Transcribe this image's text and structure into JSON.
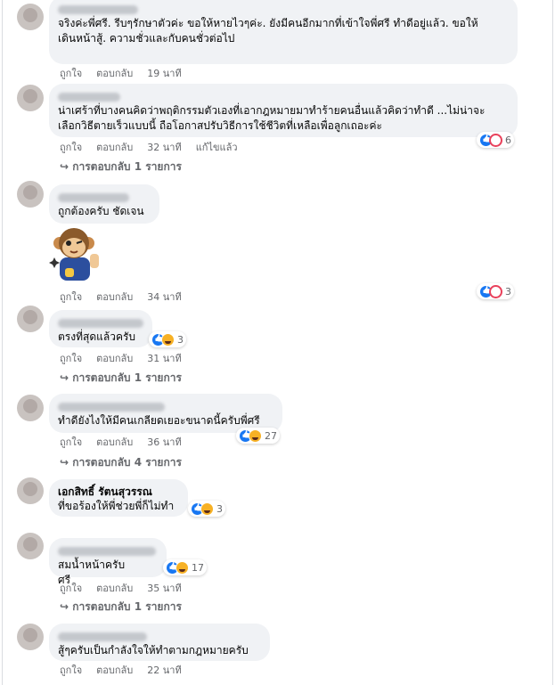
{
  "labels": {
    "like": "ถูกใจ",
    "reply": "ตอบกลับ",
    "edited": "แก้ไขแล้ว"
  },
  "comments": [
    {
      "author": "",
      "text": "จริงค่ะพี่ศรี. รีบๆรักษาตัวค่ะ ขอให้หายไวๆค่ะ. ยังมีคนอีกมากที่เข้าใจพี่ศรี ทำดีอยู่แล้ว. ขอให้\nเดินหน้าสู้. ความชั่วและกับคนชั่วต่อไป",
      "time": "19 นาที"
    },
    {
      "author": "",
      "text": "น่าเศร้าที่บางคนคิดว่าพฤติกรรมตัวเองที่เอากฎหมายมาทำร้ายคนอื่นแล้วคิดว่าทำดี ...ไม่น่าจะ\nเลือกวิธีตายเร็วแบบนี้ ถือโอกาสปรับวิธีการใช้ชีวิตที่เหลือเพื่อลูกเถอะค่ะ",
      "time": "32 นาที",
      "edited": true,
      "reactions": "6",
      "replies": "การตอบกลับ 1 รายการ"
    },
    {
      "author": "",
      "text": "ถูกต้องครับ ชัดเจน",
      "time": "34 นาที",
      "reactions": "3"
    },
    {
      "author": "",
      "text": "ตรงที่สุดแล้วครับ",
      "time": "31 นาที",
      "reactions": "3",
      "replies": "การตอบกลับ 1 รายการ"
    },
    {
      "author": "",
      "text": "ทำดียังไงให้มีคนเกลียดเยอะขนาดนี้ครับพี่ศรี",
      "time": "36 นาที",
      "reactions": "27",
      "replies": "การตอบกลับ 4 รายการ"
    },
    {
      "author": "เอกสิทธิ์ รัตนสุวรรณ",
      "text": "ที่ขอร้องให้พี่ช่วยพี่ก็ไม่ทำ",
      "time": "",
      "reactions": "3"
    },
    {
      "author": "",
      "text": "สมน้ำหน้าครับ      ศรี",
      "time": "35 นาที",
      "reactions": "17",
      "replies": "การตอบกลับ 1 รายการ"
    },
    {
      "author": "",
      "text": "สู้ๆครับเป็นกำลังใจให้ทำตามกฎหมายครับ",
      "time": "22 นาที"
    }
  ]
}
